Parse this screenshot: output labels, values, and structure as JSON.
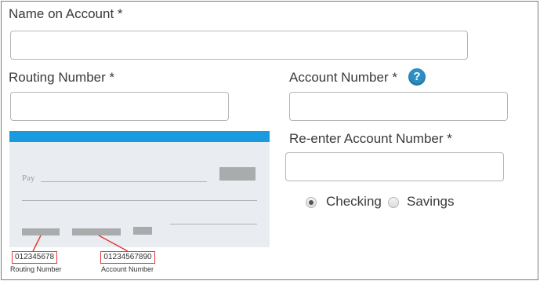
{
  "form": {
    "name_label": "Name on Account *",
    "name_value": "",
    "routing_label": "Routing Number *",
    "routing_value": "",
    "account_label": "Account Number *",
    "account_help": "?",
    "account_value": "",
    "reenter_label": "Re-enter Account Number *",
    "reenter_value": "",
    "account_type": {
      "options": [
        "Checking",
        "Savings"
      ],
      "selected": "Checking"
    }
  },
  "check": {
    "pay_label": "Pay",
    "routing_sample": "012345678",
    "account_sample": "01234567890",
    "routing_caption": "Routing Number",
    "account_caption": "Account Number",
    "colors": {
      "top_bar": "#1a9be0",
      "highlight": "#e53935",
      "background": "#e9ecf0"
    }
  },
  "colors": {
    "help_icon": "#2e8fc4"
  }
}
